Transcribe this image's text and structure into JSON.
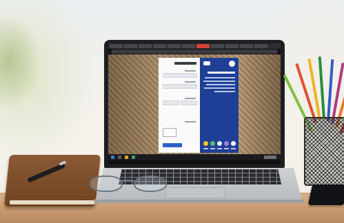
{
  "scene": {
    "objects": [
      "laptop",
      "notebook",
      "pen",
      "glasses",
      "pencil-cup",
      "phone",
      "desk"
    ]
  },
  "screen": {
    "browser_tabs": [
      "",
      "",
      "",
      "",
      "",
      "",
      "",
      "",
      "",
      "",
      ""
    ],
    "active_tab_index": 6,
    "address_bar": "",
    "login_form": {
      "title": "",
      "username_label": "",
      "username_value": "",
      "password_label": "",
      "password_value": "",
      "captcha_label": "",
      "captcha_value": "",
      "submit_label": ""
    },
    "info_panel": {
      "heading": "",
      "body": "",
      "icons": [
        "app-icon-1",
        "app-icon-2",
        "app-icon-3",
        "app-icon-4",
        "app-icon-5"
      ]
    }
  },
  "colors": {
    "info_panel": "#1e3f95",
    "submit_button": "#2a63c6",
    "active_tab": "#d9403a",
    "desk": "#c99a70",
    "notebook": "#70421f"
  }
}
